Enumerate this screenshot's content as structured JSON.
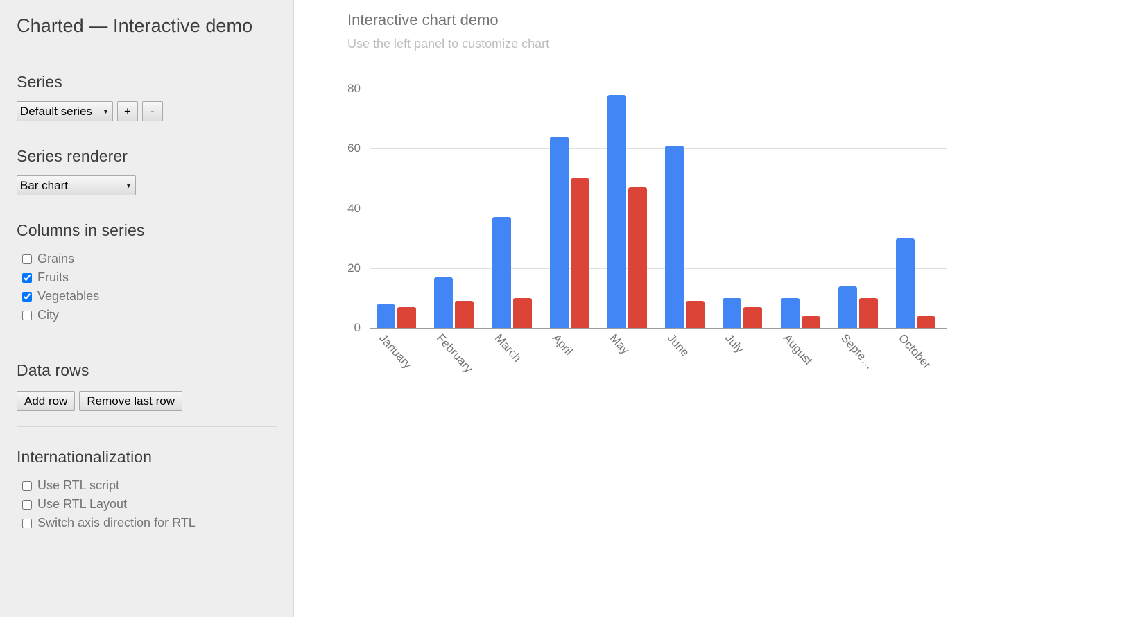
{
  "sidebar": {
    "app_title": "Charted — Interactive demo",
    "series": {
      "heading": "Series",
      "selected": "Default series",
      "options": [
        "Default series"
      ],
      "add_label": "+",
      "remove_label": "-"
    },
    "renderer": {
      "heading": "Series renderer",
      "selected": "Bar chart",
      "options": [
        "Bar chart"
      ]
    },
    "columns": {
      "heading": "Columns in series",
      "items": [
        {
          "label": "Grains",
          "checked": false
        },
        {
          "label": "Fruits",
          "checked": true
        },
        {
          "label": "Vegetables",
          "checked": true
        },
        {
          "label": "City",
          "checked": false
        }
      ]
    },
    "data_rows": {
      "heading": "Data rows",
      "add_label": "Add row",
      "remove_label": "Remove last row"
    },
    "i18n": {
      "heading": "Internationalization",
      "items": [
        {
          "label": "Use RTL script",
          "checked": false
        },
        {
          "label": "Use RTL Layout",
          "checked": false
        },
        {
          "label": "Switch axis direction for RTL",
          "checked": false
        }
      ]
    }
  },
  "chart_header": {
    "title": "Interactive chart demo",
    "subtitle": "Use the left panel to customize chart"
  },
  "colors": {
    "fruits": "#4285F4",
    "vegetables": "#DB4437",
    "gridline": "#e0e0e0",
    "axis": "#9e9e9e",
    "tick_text": "#757575",
    "sidebar_bg": "#eeeeee"
  },
  "chart_data": {
    "type": "bar",
    "title": "Interactive chart demo",
    "subtitle": "Use the left panel to customize chart",
    "xlabel": "",
    "ylabel": "",
    "ylim": [
      0,
      80
    ],
    "yticks": [
      0,
      20,
      40,
      60,
      80
    ],
    "grid": true,
    "legend_position": "right",
    "categories": [
      "January",
      "February",
      "March",
      "April",
      "May",
      "June",
      "July",
      "August",
      "Septe…",
      "October"
    ],
    "series": [
      {
        "name": "Fruits",
        "color": "#4285F4",
        "values": [
          8,
          17,
          37,
          64,
          78,
          61,
          10,
          10,
          14,
          30
        ]
      },
      {
        "name": "Vegetables",
        "color": "#DB4437",
        "values": [
          7,
          9,
          10,
          50,
          47,
          9,
          7,
          4,
          10,
          4
        ]
      }
    ]
  }
}
